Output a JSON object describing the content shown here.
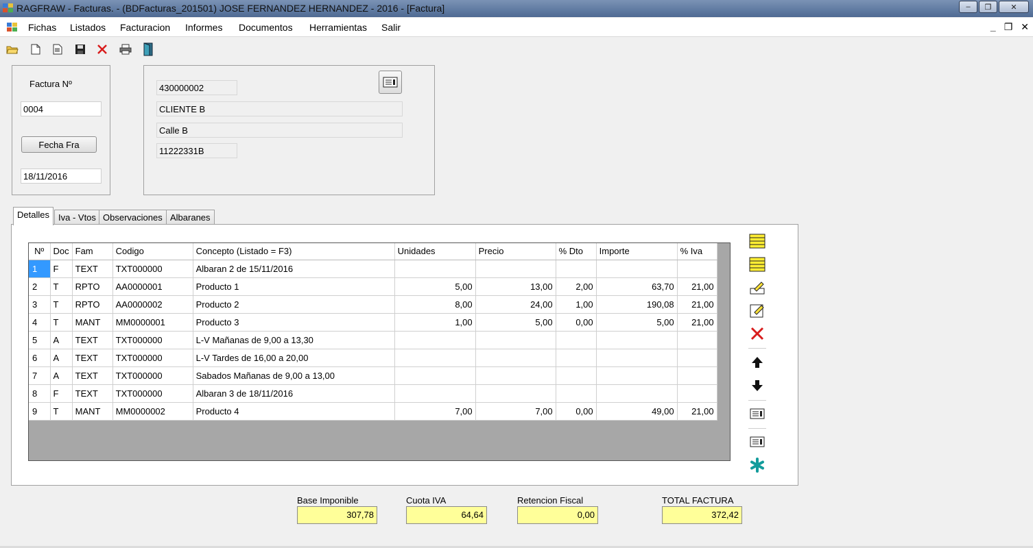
{
  "window": {
    "title": "RAGFRAW - Facturas. - (BDFacturas_201501)   JOSE FERNANDEZ HERNANDEZ - 2016 - [Factura]",
    "minimize": "‒",
    "maximize": "❐",
    "close": "✕"
  },
  "menu": {
    "items": [
      "Fichas",
      "Listados",
      "Facturacion",
      "Informes",
      "Documentos",
      "Herramientas",
      "Salir"
    ],
    "mdi_minimize": "_",
    "mdi_restore": "❐",
    "mdi_close": "✕"
  },
  "invoice": {
    "factura_label": "Factura Nº",
    "factura_number": "0004",
    "fecha_button": "Fecha Fra",
    "fecha": "18/11/2016"
  },
  "client": {
    "code": "430000002",
    "name": "CLIENTE B",
    "address": "Calle B",
    "nif": "11222331B"
  },
  "tabs": [
    "Detalles",
    "Iva - Vtos",
    "Observaciones",
    "Albaranes"
  ],
  "grid": {
    "columns": [
      "Nº",
      "Doc",
      "Fam",
      "Codigo",
      "Concepto   (Listado = F3)",
      "Unidades",
      "Precio",
      "% Dto",
      "Importe",
      "% Iva"
    ],
    "rows": [
      {
        "n": "1",
        "doc": "F",
        "fam": "TEXT",
        "codigo": "TXT000000",
        "concepto": "Albaran 2 de 15/11/2016",
        "unidades": "",
        "precio": "",
        "dto": "",
        "importe": "",
        "iva": ""
      },
      {
        "n": "2",
        "doc": "T",
        "fam": "RPTO",
        "codigo": "AA0000001",
        "concepto": "Producto 1",
        "unidades": "5,00",
        "precio": "13,00",
        "dto": "2,00",
        "importe": "63,70",
        "iva": "21,00"
      },
      {
        "n": "3",
        "doc": "T",
        "fam": "RPTO",
        "codigo": "AA0000002",
        "concepto": "Producto 2",
        "unidades": "8,00",
        "precio": "24,00",
        "dto": "1,00",
        "importe": "190,08",
        "iva": "21,00"
      },
      {
        "n": "4",
        "doc": "T",
        "fam": "MANT",
        "codigo": "MM0000001",
        "concepto": "Producto 3",
        "unidades": "1,00",
        "precio": "5,00",
        "dto": "0,00",
        "importe": "5,00",
        "iva": "21,00"
      },
      {
        "n": "5",
        "doc": "A",
        "fam": "TEXT",
        "codigo": "TXT000000",
        "concepto": "L-V Mañanas de 9,00 a 13,30",
        "unidades": "",
        "precio": "",
        "dto": "",
        "importe": "",
        "iva": ""
      },
      {
        "n": "6",
        "doc": "A",
        "fam": "TEXT",
        "codigo": "TXT000000",
        "concepto": "L-V Tardes de 16,00 a 20,00",
        "unidades": "",
        "precio": "",
        "dto": "",
        "importe": "",
        "iva": ""
      },
      {
        "n": "7",
        "doc": "A",
        "fam": "TEXT",
        "codigo": "TXT000000",
        "concepto": "Sabados Mañanas de 9,00 a 13,00",
        "unidades": "",
        "precio": "",
        "dto": "",
        "importe": "",
        "iva": ""
      },
      {
        "n": "8",
        "doc": "F",
        "fam": "TEXT",
        "codigo": "TXT000000",
        "concepto": "Albaran 3 de 18/11/2016",
        "unidades": "",
        "precio": "",
        "dto": "",
        "importe": "",
        "iva": ""
      },
      {
        "n": "9",
        "doc": "T",
        "fam": "MANT",
        "codigo": "MM0000002",
        "concepto": "Producto 4",
        "unidades": "7,00",
        "precio": "7,00",
        "dto": "0,00",
        "importe": "49,00",
        "iva": "21,00"
      }
    ]
  },
  "totals": {
    "base_label": "Base Imponible",
    "base_value": "307,78",
    "cuota_label": "Cuota IVA",
    "cuota_value": "64,64",
    "retencion_label": "Retencion Fiscal",
    "retencion_value": "0,00",
    "total_label": "TOTAL FACTURA",
    "total_value": "372,42"
  },
  "colors": {
    "total_field": "#ffff99",
    "selected_row": "#3399ff",
    "grid_background": "#a7a7a7"
  }
}
